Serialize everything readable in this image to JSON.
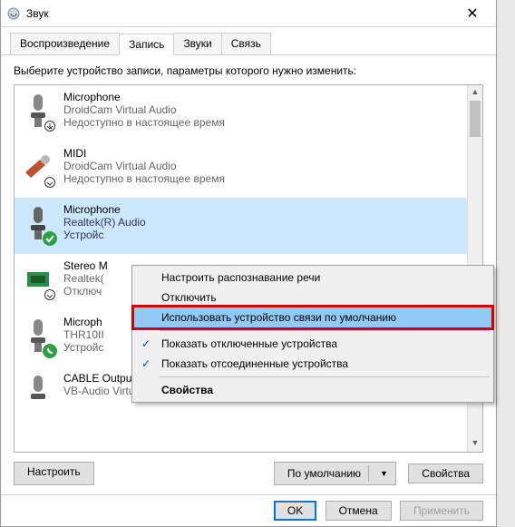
{
  "window": {
    "title": "Звук",
    "close_glyph": "✕"
  },
  "tabs": [
    {
      "label": "Воспроизведение"
    },
    {
      "label": "Запись"
    },
    {
      "label": "Звуки"
    },
    {
      "label": "Связь"
    }
  ],
  "instruction": "Выберите устройство записи, параметры которого нужно изменить:",
  "devices": [
    {
      "name": "Microphone",
      "sub": "DroidCam Virtual Audio",
      "status": "Недоступно в настоящее время",
      "icon": "mic",
      "badge": "down"
    },
    {
      "name": "MIDI",
      "sub": "DroidCam Virtual Audio",
      "status": "Недоступно в настоящее время",
      "icon": "jack",
      "badge": "down"
    },
    {
      "name": "Microphone",
      "sub": "Realtek(R) Audio",
      "status": "Устройс",
      "icon": "mic",
      "badge": "check",
      "selected": true
    },
    {
      "name": "Stereo M",
      "sub": "Realtek(",
      "status": "Отключ",
      "icon": "chip",
      "badge": "down"
    },
    {
      "name": "Microph",
      "sub": "THR10II",
      "status": "Устройс",
      "icon": "mic",
      "badge": "phone"
    },
    {
      "name": "CABLE Output",
      "sub": "VB-Audio Virtual Cable",
      "status": "",
      "icon": "mic",
      "badge": ""
    }
  ],
  "scroll": {
    "up": "▲",
    "down": "▼"
  },
  "buttons": {
    "configure": "Настроить",
    "default": "По умолчанию",
    "properties": "Свойства"
  },
  "footer": {
    "ok": "OK",
    "cancel": "Отмена",
    "apply": "Применить"
  },
  "context_menu": {
    "items": [
      {
        "label": "Настроить распознавание речи"
      },
      {
        "label": "Отключить"
      },
      {
        "label": "Использовать устройство связи по умолчанию",
        "highlight": true,
        "ring": true
      },
      {
        "sep": true
      },
      {
        "label": "Показать отключенные устройства",
        "checked": true
      },
      {
        "label": "Показать отсоединенные устройства",
        "checked": true
      },
      {
        "sep": true
      },
      {
        "label": "Свойства",
        "bold": true
      }
    ]
  }
}
